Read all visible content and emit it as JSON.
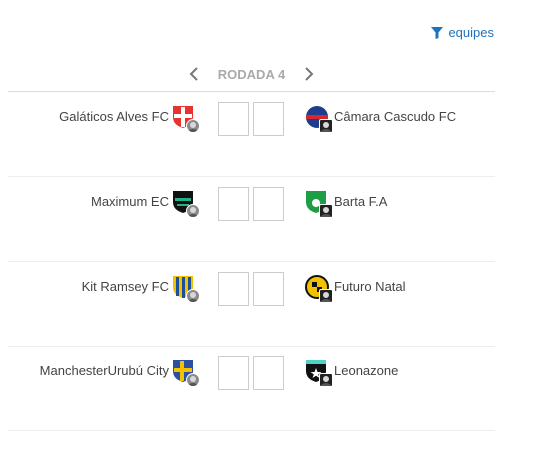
{
  "filter": {
    "label": "equipes",
    "icon": "filter-icon"
  },
  "round": {
    "label": "RODADA 4",
    "prev_icon": "chevron-left-icon",
    "next_icon": "chevron-right-icon"
  },
  "matches": [
    {
      "home": "Galáticos Alves FC",
      "away": "Câmara Cascudo FC",
      "home_score": "",
      "away_score": ""
    },
    {
      "home": "Maximum EC",
      "away": "Barta F.A",
      "home_score": "",
      "away_score": ""
    },
    {
      "home": "Kit Ramsey FC",
      "away": "Futuro Natal",
      "home_score": "",
      "away_score": ""
    },
    {
      "home": "ManchesterUrubú City",
      "away": "Leonazone",
      "home_score": "",
      "away_score": ""
    }
  ],
  "colors": {
    "accent": "#1e73be",
    "round_label": "#aaaaaa"
  }
}
